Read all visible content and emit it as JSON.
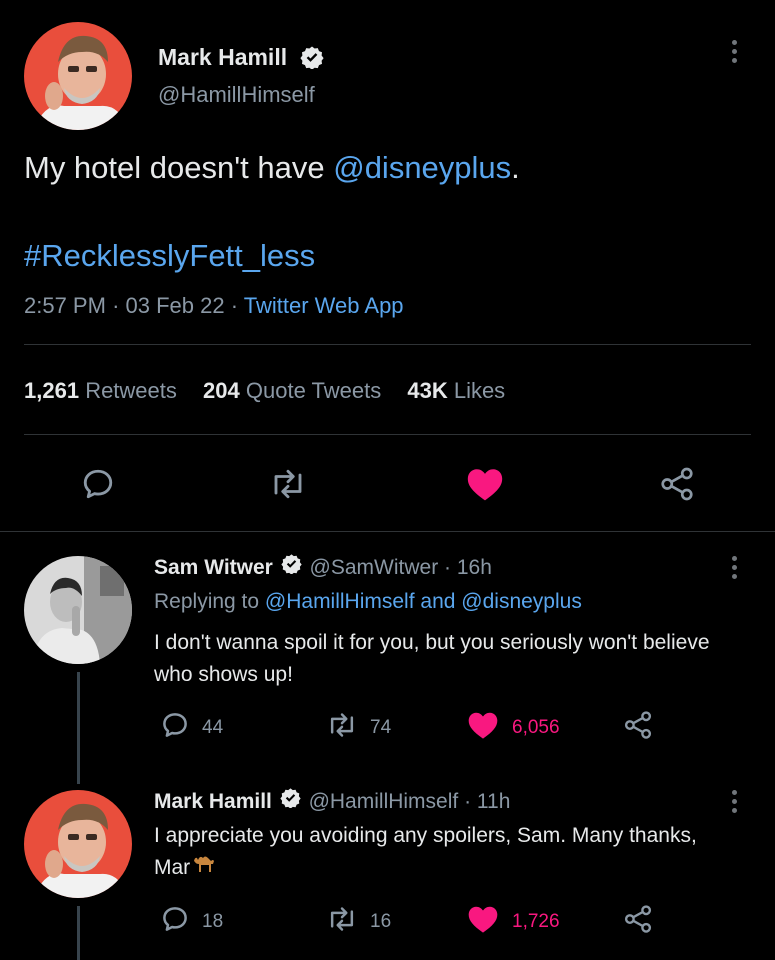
{
  "main_tweet": {
    "display_name": "Mark Hamill",
    "handle": "@HamillHimself",
    "text_prefix": "My hotel doesn't have ",
    "mention": "@disneyplus",
    "text_suffix": ".",
    "hashtag": "#RecklesslyFett_less",
    "time": "2:57 PM",
    "date": "03 Feb 22",
    "separator": "·",
    "source": "Twitter Web App",
    "stats": {
      "retweets_count": "1,261",
      "retweets_label": "Retweets",
      "quotes_count": "204",
      "quotes_label": "Quote Tweets",
      "likes_count": "43K",
      "likes_label": "Likes"
    }
  },
  "replies": [
    {
      "display_name": "Sam Witwer",
      "handle": "@SamWitwer",
      "age": "· 16h",
      "replying_prefix": "Replying to ",
      "replying_user1": "@HamillHimself",
      "replying_and": " and ",
      "replying_user2": "@disneyplus",
      "text": "I don't wanna spoil it for you, but you seriously won't believe who shows up!",
      "replies": "44",
      "retweets": "74",
      "likes": "6,056"
    },
    {
      "display_name": "Mark Hamill",
      "handle": "@HamillHimself",
      "age": "· 11h",
      "text": "I appreciate you avoiding any spoilers, Sam. Many thanks, Mar",
      "replies": "18",
      "retweets": "16",
      "likes": "1,726"
    }
  ],
  "colors": {
    "background": "#000000",
    "link": "#5aa6ee",
    "like": "#f91880",
    "muted": "#8b98a5",
    "verified": "#e7e9ea"
  },
  "icons": [
    "verified-icon",
    "more-icon",
    "reply-icon",
    "retweet-icon",
    "heart-icon",
    "share-icon",
    "camel-emoji"
  ]
}
